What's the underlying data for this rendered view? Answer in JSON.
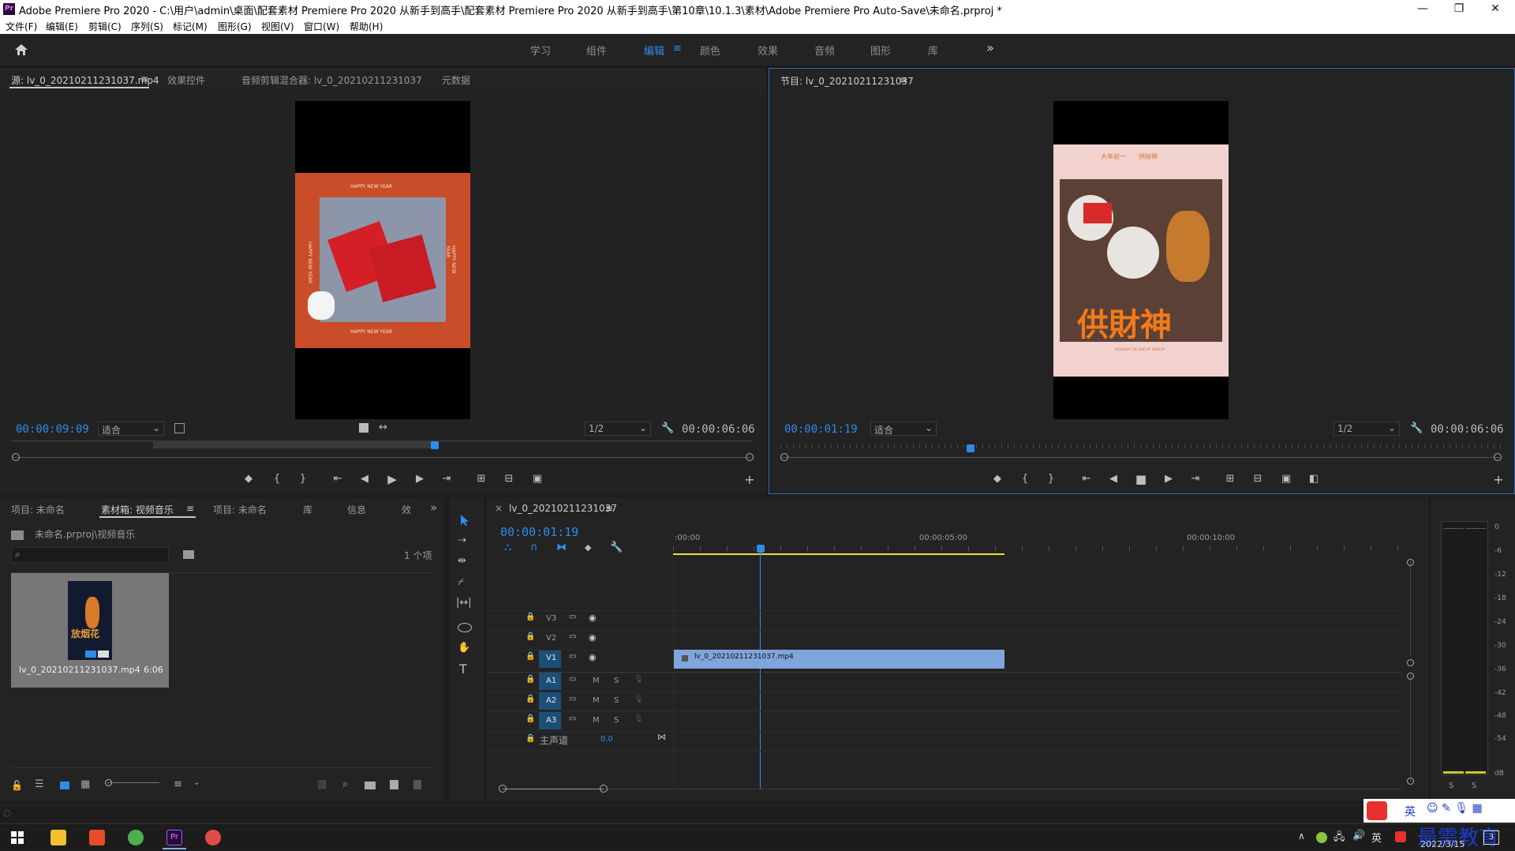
{
  "title_bar": {
    "app_logo": "Pr",
    "title": "Adobe Premiere Pro 2020 - C:\\用户\\admin\\桌面\\配套素材 Premiere Pro 2020 从新手到高手\\配套素材 Premiere Pro 2020 从新手到高手\\第10章\\10.1.3\\素材\\Adobe Premiere Pro Auto-Save\\未命名.prproj *",
    "minimize": "—",
    "maximize": "❐",
    "close": "✕"
  },
  "menu": [
    "文件(F)",
    "编辑(E)",
    "剪辑(C)",
    "序列(S)",
    "标记(M)",
    "图形(G)",
    "视图(V)",
    "窗口(W)",
    "帮助(H)"
  ],
  "workspaces": [
    "学习",
    "组件",
    "编辑",
    "颜色",
    "效果",
    "音频",
    "图形",
    "库"
  ],
  "workspace_active_menu": "≡",
  "workspace_more": "»",
  "source_monitor": {
    "tabs": [
      "源: lv_0_20210211231037.mp4",
      "效果控件",
      "音频剪辑混合器: lv_0_20210211231037",
      "元数据"
    ],
    "tab_menu": "≡",
    "timecode": "00:00:09:09",
    "fit": "适合",
    "resolution": "1/2",
    "duration": "00:00:06:06",
    "frame_texts": [
      "HAPPY NEW YEAR",
      "HAPPY NEW YEAR",
      "HAPPY NEW YEAR",
      "HAPPY NEW YEAR"
    ]
  },
  "program_monitor": {
    "title": "节目: lv_0_20210211231037",
    "tab_menu": "≡",
    "timecode": "00:00:01:19",
    "fit": "适合",
    "resolution": "1/2",
    "duration": "00:00:06:06",
    "frame_top": "大年初一　　供财神",
    "frame_big": "供財神",
    "frame_small": "WORSHIP THE GOD OF WEALTH"
  },
  "project_panel": {
    "tabs": [
      "项目: 未命名",
      "素材箱: 视频音乐",
      "项目: 未命名",
      "库",
      "信息",
      "效"
    ],
    "tab_menu": "≡",
    "more": "»",
    "path": "未命名.prproj\\视频音乐",
    "count": "1 个项",
    "clip_name": "lv_0_20210211231037.mp4",
    "clip_duration": "6:06",
    "thumb_text": "放烟花"
  },
  "timeline": {
    "close": "×",
    "name": "lv_0_20210211231037",
    "tab_menu": "≡",
    "timecode": "00:00:01:19",
    "ruler": [
      ":00:00",
      "00:00:05:00",
      "00:00:10:00"
    ],
    "video_tracks": [
      "V3",
      "V2",
      "V1"
    ],
    "audio_tracks": [
      "A1",
      "A2",
      "A3"
    ],
    "mute": "M",
    "solo": "S",
    "master": "主声道",
    "master_val": "0.0",
    "clip": "lv_0_20210211231037.mp4"
  },
  "meter": {
    "scale": [
      "0",
      "-6",
      "-12",
      "-18",
      "-24",
      "-30",
      "-36",
      "-42",
      "-48",
      "-54",
      "dB"
    ],
    "solo": [
      "S",
      "S"
    ]
  },
  "taskbar": {
    "date": "2022/3/15",
    "ime": "英",
    "watermark": "最需教育",
    "notify": "3"
  }
}
